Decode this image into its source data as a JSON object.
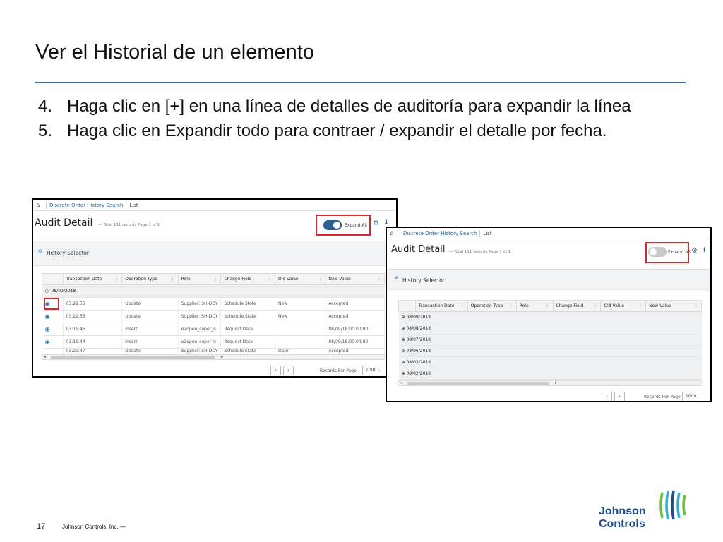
{
  "slide": {
    "title": "Ver el Historial de un elemento",
    "steps": [
      {
        "num": "4.",
        "text": "Haga clic en [+] en una línea de detalles de auditoría para expandir la línea"
      },
      {
        "num": "5.",
        "text": "Haga clic en Expandir todo para contraer / expandir el detalle por fecha."
      }
    ]
  },
  "colors": {
    "accent": "#3a6e9e",
    "highlight": "#d7262c",
    "toggle_on": "#2a5f8d",
    "toggle_off": "#c8c8c8",
    "brand_blue": "#1e4d8c",
    "brand_green": "#6cbf3b"
  },
  "screenshot_left": {
    "breadcrumb": {
      "home_icon": "home-icon",
      "link": "Discrete Order History Search",
      "current": "List"
    },
    "heading": "Audit Detail",
    "subheading": "— Total 111 records Page 1 of 1",
    "toggle": {
      "label": "Expand All",
      "state": "on"
    },
    "selector_label": "History Selector",
    "columns": [
      "Transaction Date",
      "Operation Type",
      "Role",
      "Change Field",
      "Old Value",
      "New Value"
    ],
    "group": "08/09/2018",
    "rows": [
      {
        "time": "03:22:55",
        "op": "Update",
        "role": "Supplier: SH-DOY",
        "field": "Schedule State",
        "old": "New",
        "new": "Accepted"
      },
      {
        "time": "03:22:55",
        "op": "Update",
        "role": "Supplier: SH-DOY",
        "field": "Schedule State",
        "old": "New",
        "new": "Accepted"
      },
      {
        "time": "03:19:46",
        "op": "Insert",
        "role": "e2open_super_n",
        "field": "Request Date",
        "old": "",
        "new": "08/09/18:00:00:00"
      },
      {
        "time": "03:19:44",
        "op": "Insert",
        "role": "e2open_super_n",
        "field": "Request Date",
        "old": "",
        "new": "08/09/18:00:00:00"
      },
      {
        "time": "03:22:47",
        "op": "Update",
        "role": "Supplier: SH-DOY",
        "field": "Schedule State",
        "old": "Open",
        "new": "Accepted"
      }
    ],
    "pager": {
      "prev": "‹",
      "next": "›",
      "records_label": "Records Per Page",
      "records_value": "1000 ⌄"
    }
  },
  "screenshot_right": {
    "breadcrumb": {
      "home_icon": "home-icon",
      "link": "Discrete Order History Search",
      "current": "List"
    },
    "heading": "Audit Detail",
    "subheading": "— Total 111 records Page 1 of 1",
    "toggle": {
      "label": "Expand All",
      "state": "off"
    },
    "selector_label": "History Selector",
    "columns": [
      "Transaction Date",
      "Operation Type",
      "Role",
      "Change Field",
      "Old Value",
      "New Value"
    ],
    "groups": [
      "08/09/2018",
      "08/08/2018",
      "08/07/2018",
      "08/06/2018",
      "08/03/2018",
      "08/02/2018"
    ],
    "pager": {
      "prev": "‹",
      "next": "›",
      "records_label": "Records Per Page",
      "records_value": "1000 ⌄"
    }
  },
  "footer": {
    "page_number": "17",
    "company": "Johnson Controls, Inc. —"
  },
  "logo": {
    "line1": "Johnson",
    "line2": "Controls"
  }
}
